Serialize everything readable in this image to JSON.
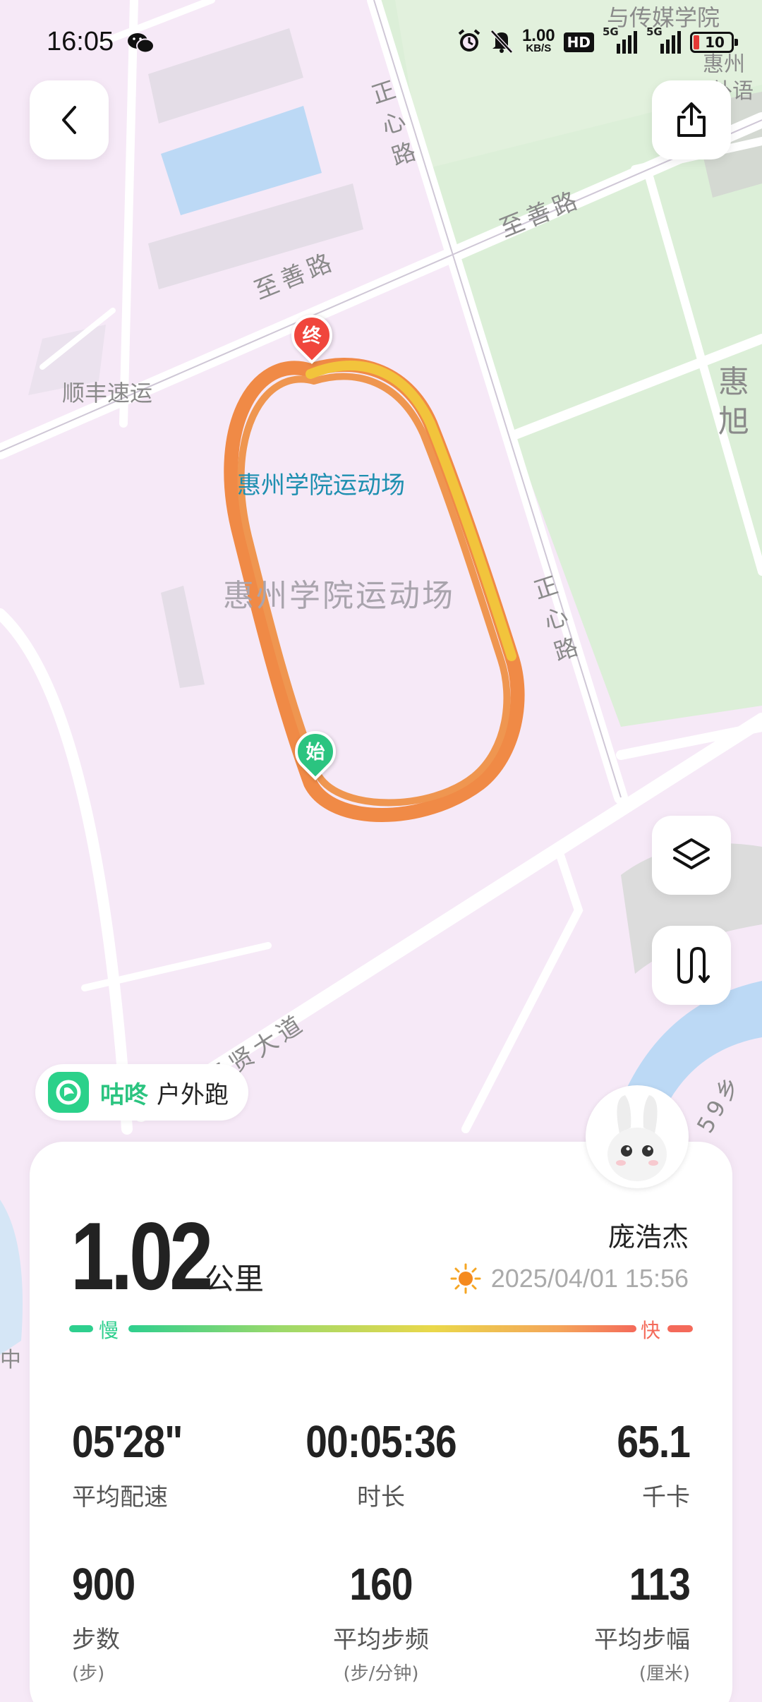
{
  "status_bar": {
    "time": "16:05",
    "net_speed_value": "1.00",
    "net_speed_unit": "KB/S",
    "hd_label": "HD",
    "signal1_label": "5G",
    "signal2_label": "5G",
    "battery_level": "10"
  },
  "map": {
    "roads": {
      "zhishan_road_1": "至善路",
      "zhishan_road_2": "至善路",
      "zhengxin_road_1": [
        "正",
        "心",
        "路"
      ],
      "zhengxin_road_2": [
        "正",
        "心",
        "路"
      ],
      "xian_avenue": "圣贤大道",
      "road_59": "59乡"
    },
    "pois": {
      "shunfeng": "顺丰速运",
      "stadium_highlight": "惠州学院运动场",
      "stadium_area": "惠州学院运动场",
      "media_college": "与传媒学院",
      "foreign_lang_1": "惠州",
      "foreign_lang_2": "外语",
      "huixu": [
        "惠",
        "旭"
      ],
      "zhong": "中"
    },
    "markers": {
      "start": "始",
      "end": "终"
    },
    "colors": {
      "track_main": "#f08a46",
      "track_fast": "#f2c43c",
      "start_marker": "#2bc480",
      "end_marker": "#f0463c",
      "water": "#bcd9f5",
      "green_area": "#dcefd8"
    }
  },
  "buttons": {
    "back_icon": "chevron-left-icon",
    "share_icon": "share-icon",
    "layers_icon": "layers-icon",
    "route_icon": "route-icon"
  },
  "app_tag": {
    "app_name": "咕咚",
    "activity": "户外跑"
  },
  "summary": {
    "distance_value": "1.02",
    "distance_unit": "公里",
    "user_name": "庞浩杰",
    "datetime": "2025/04/01 15:56",
    "weather_icon": "sun-icon",
    "pace_slow_label": "慢",
    "pace_fast_label": "快"
  },
  "stats": [
    {
      "value": "05'28\"",
      "label": "平均配速",
      "unit": ""
    },
    {
      "value": "00:05:36",
      "label": "时长",
      "unit": ""
    },
    {
      "value": "65.1",
      "label": "千卡",
      "unit": ""
    },
    {
      "value": "900",
      "label": "步数",
      "unit": "(步)"
    },
    {
      "value": "160",
      "label": "平均步频",
      "unit": "(步/分钟)"
    },
    {
      "value": "113",
      "label": "平均步幅",
      "unit": "(厘米)"
    }
  ]
}
